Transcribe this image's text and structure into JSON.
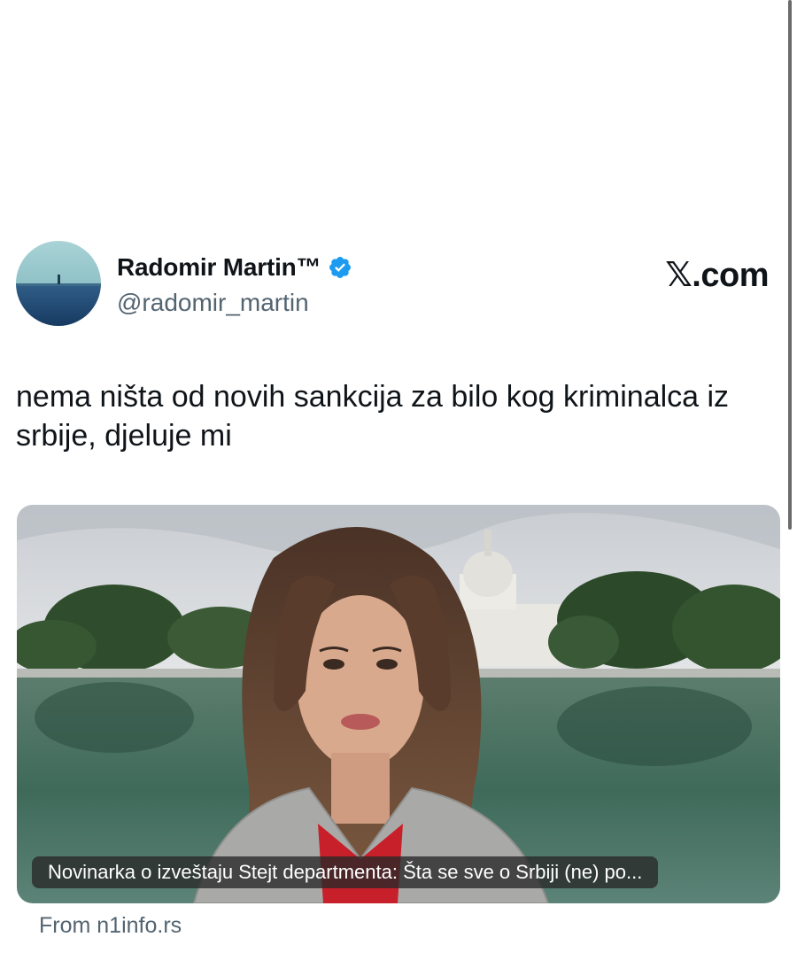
{
  "tweet": {
    "author": {
      "name": "Radomir Martin™",
      "handle": "@radomir_martin",
      "verified_icon": "verified-badge-icon",
      "avatar_icon": "avatar-seascape"
    },
    "site_logo": "𝕏.com",
    "text": "nema ništa od novih sankcija za bilo kog kriminalca iz srbije, djeluje mi",
    "media": {
      "caption": "Novinarka o izveštaju Stejt departmenta: Šta se sve o Srbiji (ne) po...",
      "image_icon": "video-thumbnail-reporter-capitol"
    },
    "source": "From n1info.rs"
  },
  "colors": {
    "text_primary": "#0f1419",
    "text_secondary": "#536471",
    "verified_blue": "#1d9bf0",
    "background": "#ffffff"
  }
}
